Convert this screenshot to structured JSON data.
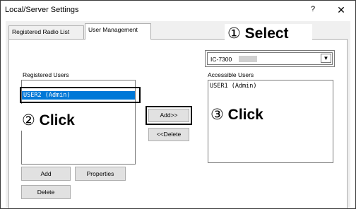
{
  "window": {
    "title": "Local/Server Settings",
    "help_label": "?",
    "close_label": "✕"
  },
  "tabs": [
    {
      "label": "Registered Radio List",
      "active": false
    },
    {
      "label": "User Management",
      "active": true
    }
  ],
  "registered_users": {
    "label": "Registered Users",
    "items": [
      {
        "text": "USER2 (Admin)",
        "selected": true
      }
    ]
  },
  "accessible_users": {
    "label": "Accessible Users",
    "items": [
      {
        "text": "USER1 (Admin)",
        "selected": false
      }
    ]
  },
  "radio_select": {
    "value": "IC-7300",
    "arrow": "▼"
  },
  "buttons": {
    "add_to": "Add>>",
    "delete_from": "<<Delete",
    "add": "Add",
    "properties": "Properties",
    "delete": "Delete"
  },
  "callouts": {
    "select_num": "①",
    "select_text": "Select",
    "click1_num": "②",
    "click1_text": "Click",
    "click2_num": "③",
    "click2_text": "Click"
  },
  "colors": {
    "selection": "#0078d7",
    "highlight_box": "#000000",
    "button_face": "#e1e1e1"
  }
}
